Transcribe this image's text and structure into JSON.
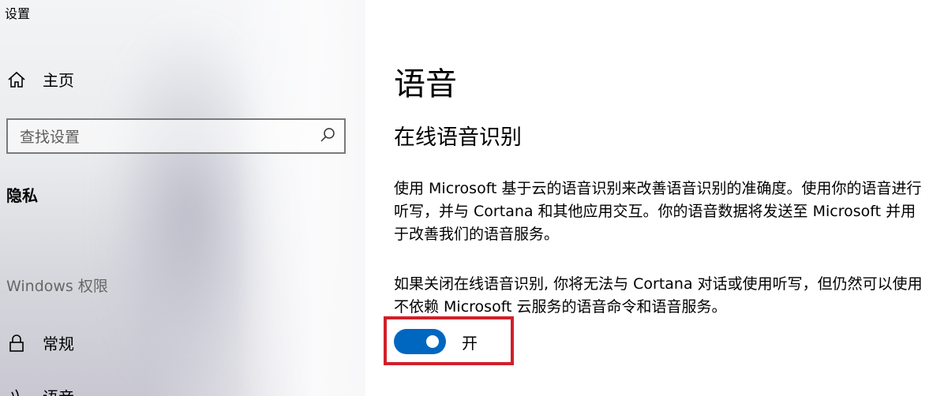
{
  "window": {
    "title": "设置"
  },
  "sidebar": {
    "home_label": "主页",
    "search_placeholder": "查找设置",
    "section_privacy": "隐私",
    "section_windows_permissions": "Windows 权限",
    "items": [
      {
        "label": "常规",
        "icon": "lock-icon"
      },
      {
        "label": "语音",
        "icon": "speech-icon"
      }
    ]
  },
  "main": {
    "page_title": "语音",
    "section_title": "在线语音识别",
    "paragraphs": [
      "使用 Microsoft 基于云的语音识别来改善语音识别的准确度。使用你的语音进行听写，并与 Cortana 和其他应用交互。你的语音数据将发送至 Microsoft 并用于改善我们的语音服务。",
      "如果关闭在线语音识别, 你将无法与 Cortana 对话或使用听写，但仍然可以使用不依赖  Microsoft 云服务的语音命令和语音服务。"
    ],
    "toggle": {
      "state_label": "开",
      "on": true
    }
  },
  "colors": {
    "accent": "#0067c0",
    "highlight": "#d0202a"
  }
}
